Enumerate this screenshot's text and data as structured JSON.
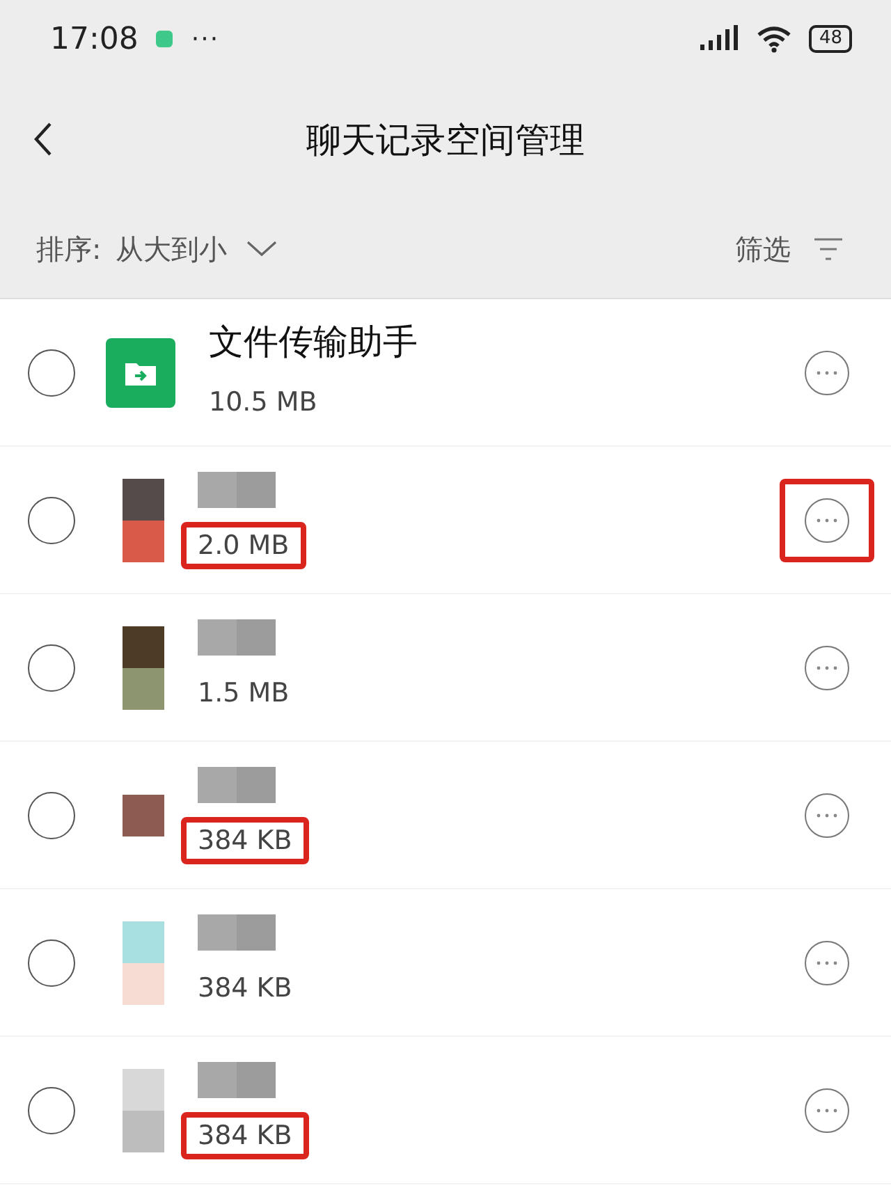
{
  "status_bar": {
    "time": "17:08",
    "more": "···",
    "battery": "48"
  },
  "nav": {
    "title": "聊天记录空间管理"
  },
  "sort_bar": {
    "label": "排序:",
    "value": "从大到小",
    "filter": "筛选"
  },
  "chats": [
    {
      "kind": "folder",
      "name": "文件传输助手",
      "name_hidden": false,
      "size": "10.5 MB",
      "size_highlighted": false,
      "more_highlighted": false,
      "checked": false
    },
    {
      "kind": "mosaic",
      "name_hidden": true,
      "size": "2.0 MB",
      "size_highlighted": true,
      "more_highlighted": true,
      "checked": false
    },
    {
      "kind": "mosaic",
      "name_hidden": true,
      "size": "1.5 MB",
      "size_highlighted": false,
      "more_highlighted": false,
      "checked": false
    },
    {
      "kind": "mosaic",
      "name_hidden": true,
      "size": "384 KB",
      "size_highlighted": true,
      "more_highlighted": false,
      "checked": false
    },
    {
      "kind": "mosaic",
      "name_hidden": true,
      "size": "384 KB",
      "size_highlighted": false,
      "more_highlighted": false,
      "checked": false
    },
    {
      "kind": "mosaic",
      "name_hidden": true,
      "size": "384 KB",
      "size_highlighted": true,
      "more_highlighted": false,
      "checked": false
    }
  ]
}
